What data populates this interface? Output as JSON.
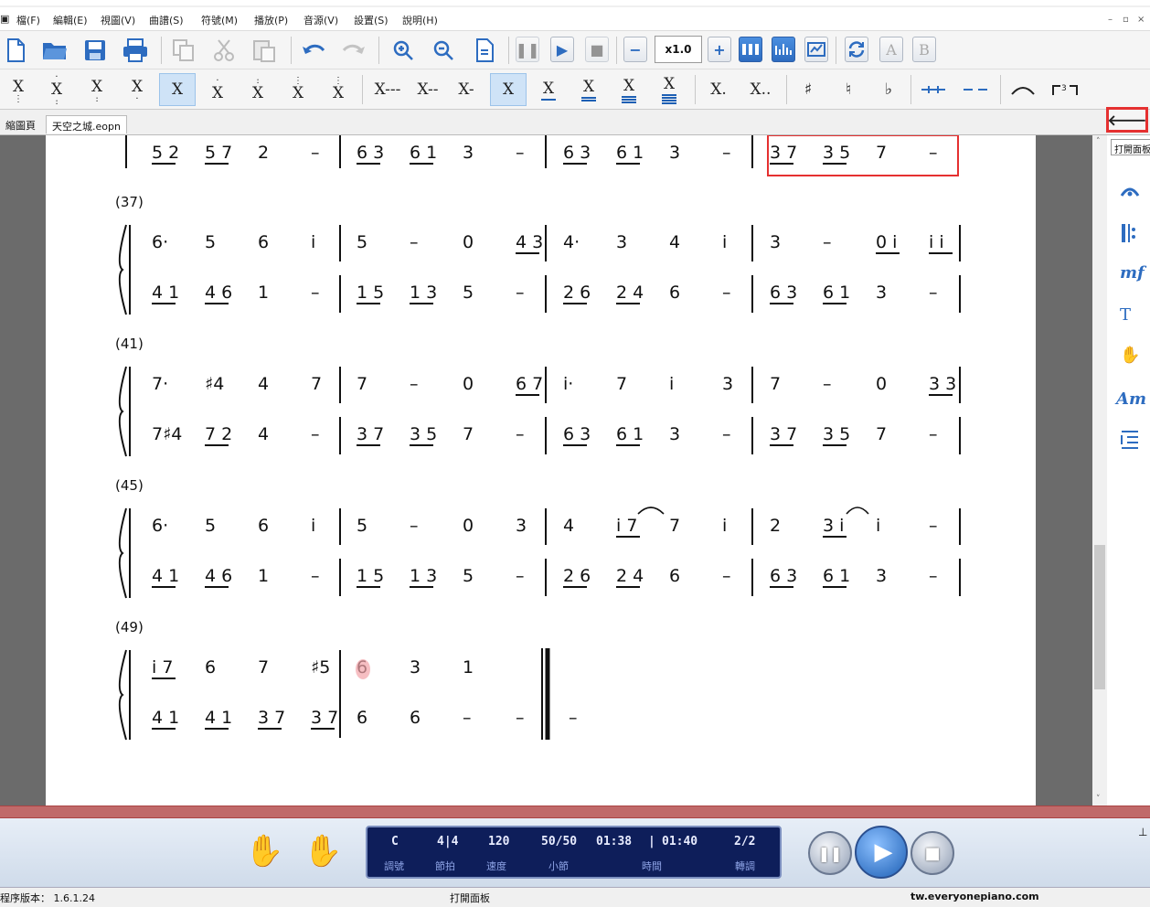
{
  "menu": [
    "檔(F)",
    "編輯(E)",
    "視圖(V)",
    "曲譜(S)",
    "符號(M)",
    "播放(P)",
    "音源(V)",
    "設置(S)",
    "說明(H)"
  ],
  "window": {
    "title": "天空之城.eopn"
  },
  "toolbar": {
    "zoom_value": "x1.0",
    "btn_a": "A",
    "btn_b": "B"
  },
  "note_buttons": {
    "notes": [
      "X",
      "X",
      "X",
      "X",
      "X",
      "X",
      "X",
      "X",
      "X"
    ],
    "durations": [
      "X---",
      "X--",
      "X-",
      "X",
      "X",
      "X",
      "X",
      "X"
    ],
    "dots": [
      "X.",
      "X.."
    ],
    "accidentals": [
      "♯",
      "♮",
      "♭"
    ]
  },
  "tabs": [
    "縮圖頁",
    "天空之城.eopn"
  ],
  "side_panel": {
    "tooltip": "打開面板",
    "icons": [
      "fermata-icon",
      "repeat-icon",
      "dynamics-icon",
      "text-icon",
      "hand-icon",
      "chord-icon",
      "list-icon"
    ],
    "dynamics_label": "mf",
    "text_label": "T",
    "chord_label": "Am"
  },
  "score": {
    "top_row": {
      "m1": [
        "5 2",
        "5 7",
        "2",
        "–"
      ],
      "m2": [
        "6 3",
        "6 1",
        "3",
        "–"
      ],
      "m3": [
        "6 3",
        "6 1",
        "3",
        "–"
      ],
      "m4": [
        "3 7",
        "3 5",
        "7",
        "–"
      ]
    },
    "systems": [
      {
        "number": "(37)",
        "upper": [
          [
            "6·",
            "5",
            "6",
            "i"
          ],
          [
            "5",
            "–",
            "0",
            "4 3"
          ],
          [
            "4·",
            "3",
            "4",
            "i"
          ],
          [
            "3",
            "–",
            "0 i",
            "i i"
          ]
        ],
        "lower": [
          [
            "4 1",
            "4 6",
            "1",
            "–"
          ],
          [
            "1 5",
            "1 3",
            "5",
            "–"
          ],
          [
            "2 6",
            "2 4",
            "6",
            "–"
          ],
          [
            "6 3",
            "6 1",
            "3",
            "–"
          ]
        ]
      },
      {
        "number": "(41)",
        "upper": [
          [
            "7·",
            "♯4",
            "4",
            "7"
          ],
          [
            "7",
            "–",
            "0",
            "6 7"
          ],
          [
            "i·",
            "7",
            "i",
            "3"
          ],
          [
            "7",
            "–",
            "0",
            "3 3"
          ]
        ],
        "lower": [
          [
            "7♯4",
            "7 2",
            "4",
            "–"
          ],
          [
            "3 7",
            "3 5",
            "7",
            "–"
          ],
          [
            "6 3",
            "6 1",
            "3",
            "–"
          ],
          [
            "3 7",
            "3 5",
            "7",
            "–"
          ]
        ]
      },
      {
        "number": "(45)",
        "upper": [
          [
            "6·",
            "5",
            "6",
            "i"
          ],
          [
            "5",
            "–",
            "0",
            "3"
          ],
          [
            "4",
            "i 7",
            "7",
            "i"
          ],
          [
            "2",
            "3 i",
            "i",
            "–"
          ]
        ],
        "lower": [
          [
            "4 1",
            "4 6",
            "1",
            "–"
          ],
          [
            "1 5",
            "1 3",
            "5",
            "–"
          ],
          [
            "2 6",
            "2 4",
            "6",
            "–"
          ],
          [
            "6 3",
            "6 1",
            "3",
            "–"
          ]
        ]
      },
      {
        "number": "(49)",
        "upper": [
          [
            "i 7",
            "6",
            "7",
            "♯5"
          ],
          [
            "6",
            "3",
            "1"
          ]
        ],
        "lower": [
          [
            "4 1",
            "4 1",
            "3 7",
            "3 7"
          ],
          [
            "6",
            "6",
            "–",
            "–",
            "–"
          ]
        ]
      }
    ]
  },
  "player": {
    "key": "C",
    "meter": "4|4",
    "tempo": "120",
    "measure": "50/50",
    "time_current": "01:38",
    "time_sep": "|",
    "time_total": "01:40",
    "transpose": "2/2",
    "labels": [
      "調號",
      "節拍",
      "速度",
      "小節",
      "時間",
      "轉調"
    ]
  },
  "status": {
    "version": "程序版本： 1.6.1.24",
    "center": "打開面板",
    "site": "tw.everyonepiano.com"
  },
  "colors": {
    "accent": "#2d6cc0",
    "highlight": "#e53030",
    "display_bg": "#0e1e5a",
    "ruler": "#c06a6a"
  }
}
